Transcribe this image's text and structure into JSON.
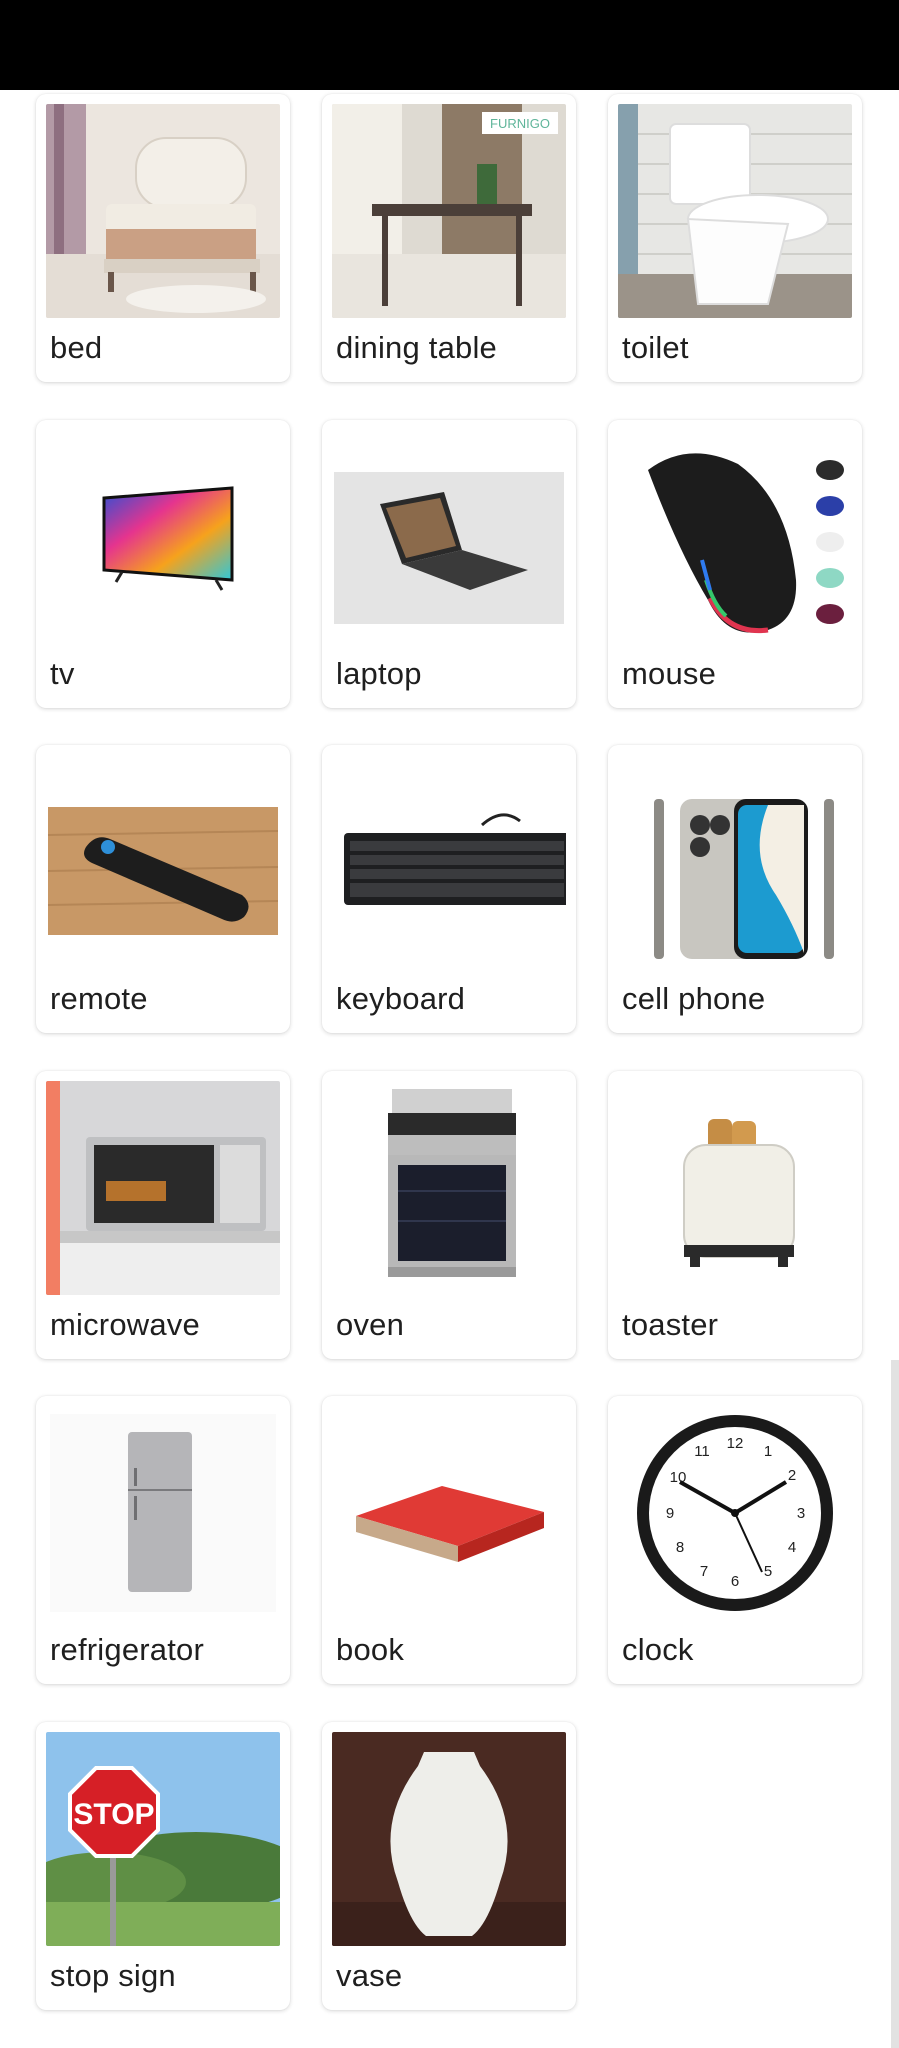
{
  "items": [
    {
      "label": "bed",
      "icon": "bed-image"
    },
    {
      "label": "dining table",
      "icon": "dining-table-image",
      "watermark": "FURNIGO"
    },
    {
      "label": "toilet",
      "icon": "toilet-image"
    },
    {
      "label": "tv",
      "icon": "tv-image"
    },
    {
      "label": "laptop",
      "icon": "laptop-image"
    },
    {
      "label": "mouse",
      "icon": "mouse-image"
    },
    {
      "label": "remote",
      "icon": "remote-image"
    },
    {
      "label": "keyboard",
      "icon": "keyboard-image"
    },
    {
      "label": "cell phone",
      "icon": "cell-phone-image"
    },
    {
      "label": "microwave",
      "icon": "microwave-image"
    },
    {
      "label": "oven",
      "icon": "oven-image"
    },
    {
      "label": "toaster",
      "icon": "toaster-image"
    },
    {
      "label": "refrigerator",
      "icon": "refrigerator-image"
    },
    {
      "label": "book",
      "icon": "book-image"
    },
    {
      "label": "clock",
      "icon": "clock-image",
      "clock_numbers": [
        "12",
        "1",
        "2",
        "3",
        "4",
        "5",
        "6",
        "7",
        "8",
        "9",
        "10",
        "11"
      ]
    },
    {
      "label": "stop sign",
      "icon": "stop-sign-image",
      "sign_text": "STOP"
    },
    {
      "label": "vase",
      "icon": "vase-image"
    }
  ]
}
